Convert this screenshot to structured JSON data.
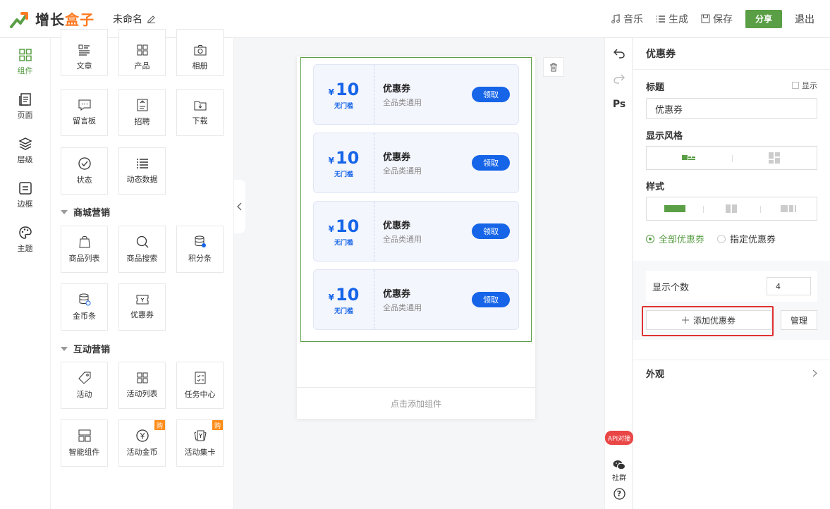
{
  "header": {
    "brand_a": "增长",
    "brand_b": "盒子",
    "doc_name": "未命名",
    "music": "音乐",
    "generate": "生成",
    "save": "保存",
    "share": "分享",
    "exit": "退出"
  },
  "rail": [
    {
      "label": "组件",
      "icon": "grid-icon"
    },
    {
      "label": "页面",
      "icon": "pages-icon"
    },
    {
      "label": "层级",
      "icon": "layers-icon"
    },
    {
      "label": "边框",
      "icon": "border-icon"
    },
    {
      "label": "主题",
      "icon": "palette-icon"
    }
  ],
  "widgets": {
    "basic": [
      "文章",
      "产品",
      "相册",
      "留言板",
      "招聘",
      "下载",
      "状态",
      "动态数据"
    ],
    "mall_title": "商城营销",
    "mall": [
      "商品列表",
      "商品搜索",
      "积分条",
      "金币条",
      "优惠券"
    ],
    "interactive_title": "互动营销",
    "interactive": [
      "活动",
      "活动列表",
      "任务中心",
      "智能组件",
      "活动金币",
      "活动集卡"
    ],
    "buy_badge": "购"
  },
  "coupons": [
    {
      "yen": "¥",
      "amount": "10",
      "condition": "无门槛",
      "name": "优惠券",
      "desc": "全品类通用",
      "action": "领取"
    },
    {
      "yen": "¥",
      "amount": "10",
      "condition": "无门槛",
      "name": "优惠券",
      "desc": "全品类通用",
      "action": "领取"
    },
    {
      "yen": "¥",
      "amount": "10",
      "condition": "无门槛",
      "name": "优惠券",
      "desc": "全品类通用",
      "action": "领取"
    },
    {
      "yen": "¥",
      "amount": "10",
      "condition": "无门槛",
      "name": "优惠券",
      "desc": "全品类通用",
      "action": "领取"
    }
  ],
  "canvas": {
    "add_component": "点击添加组件"
  },
  "tools": {
    "ps": "Ps",
    "api": "API对接",
    "community": "社群",
    "help": "?"
  },
  "settings": {
    "title": "优惠券",
    "label_title": "标题",
    "show": "显示",
    "title_value": "优惠券",
    "label_style": "显示风格",
    "label_pattern": "样式",
    "radio_all": "全部优惠券",
    "radio_specific": "指定优惠券",
    "count_label": "显示个数",
    "count_value": "4",
    "add_coupon": "添加优惠券",
    "manage": "管理",
    "appearance": "外观"
  },
  "colors": {
    "accent": "#5a9e46",
    "brand_orange": "#ff7a22",
    "coupon_blue": "#1665e8",
    "highlight_red": "#e03131"
  }
}
